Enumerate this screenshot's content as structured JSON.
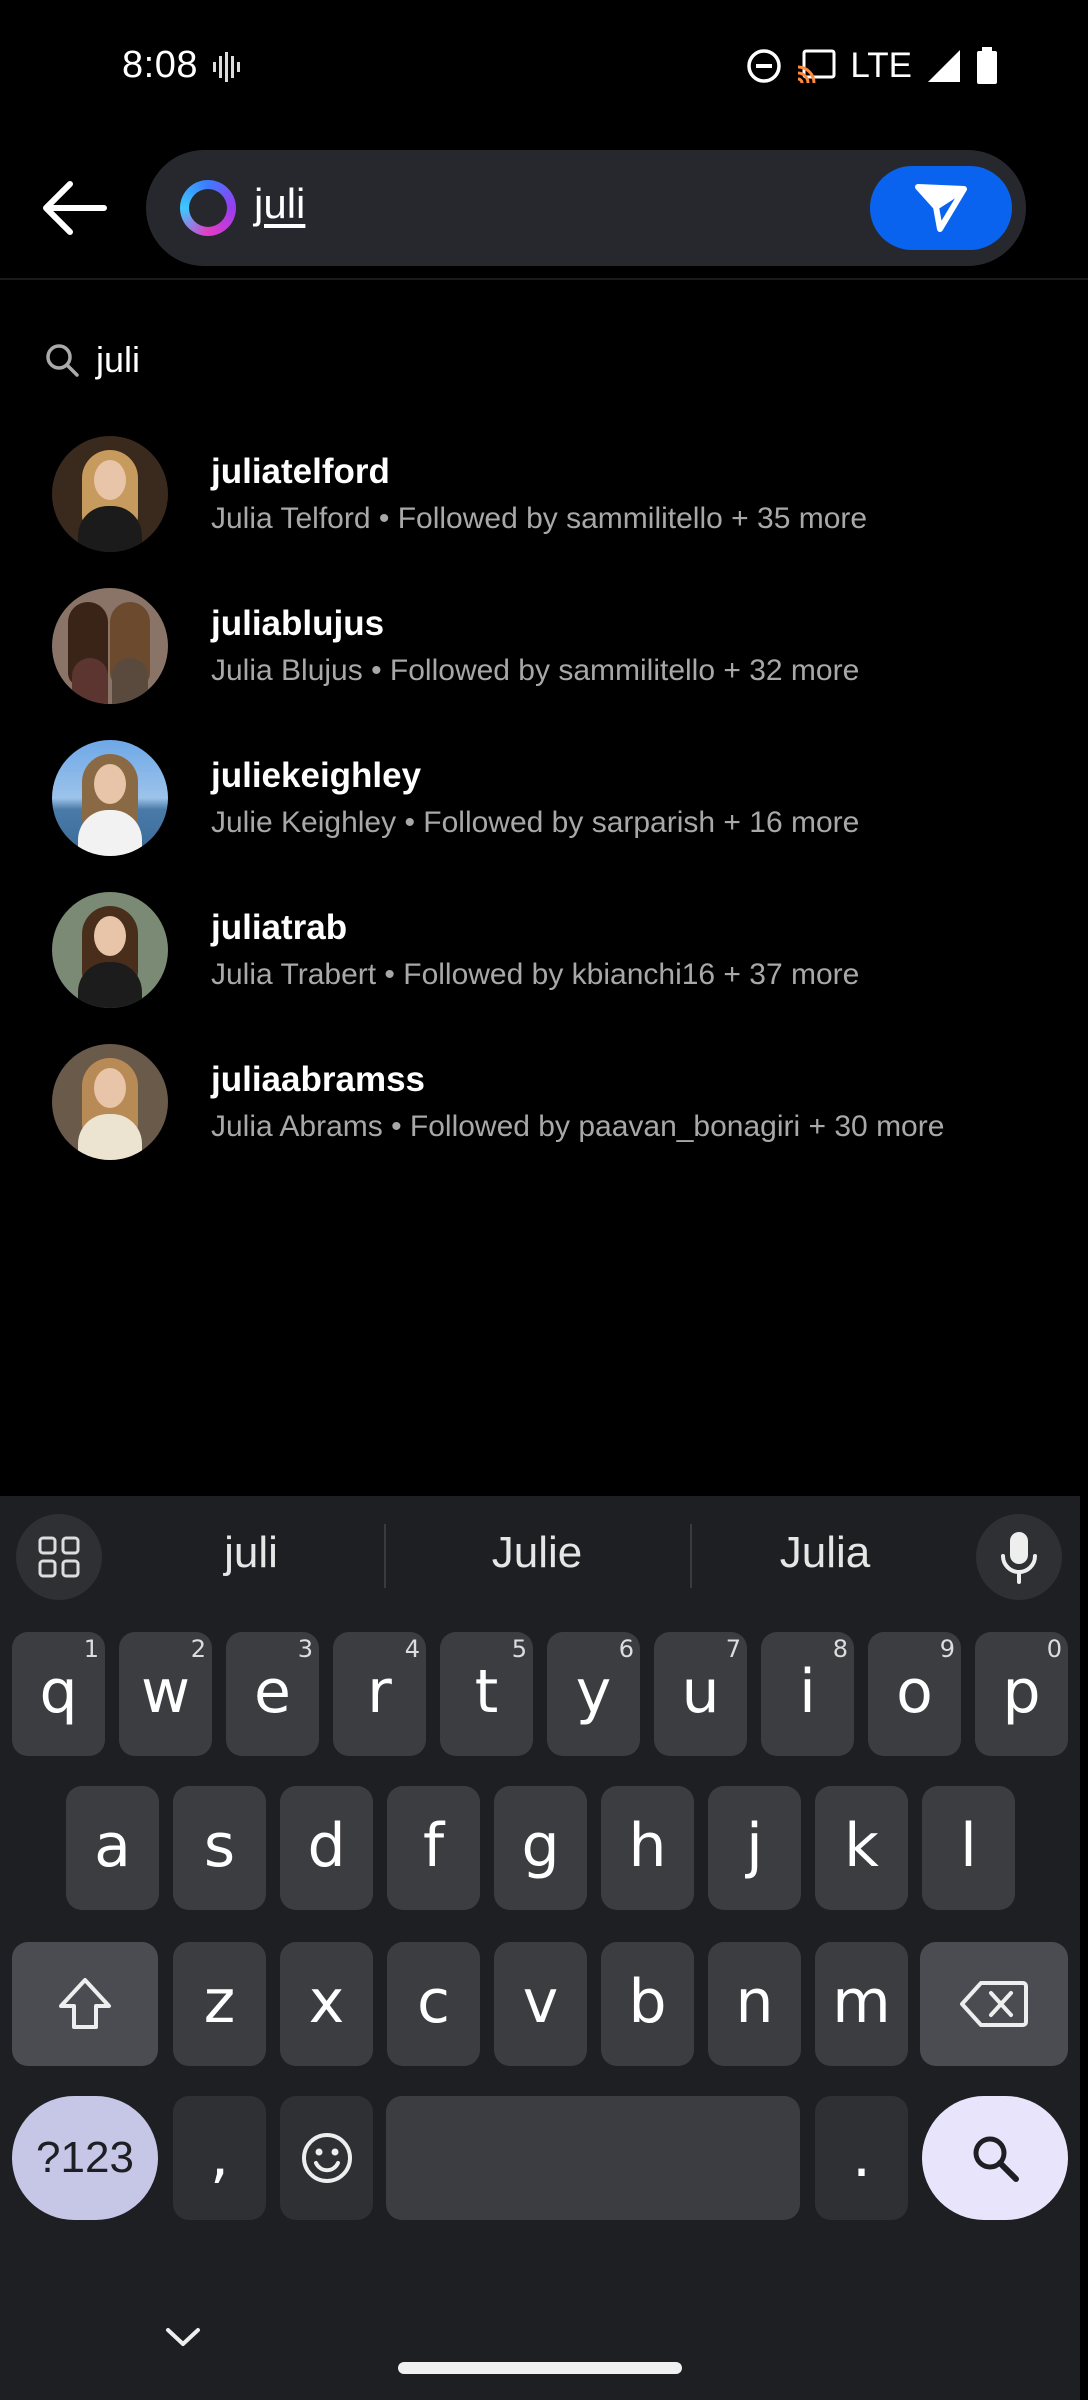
{
  "status_bar": {
    "time": "8:08",
    "network": "LTE"
  },
  "search": {
    "query": "juli",
    "suggestion": "juli"
  },
  "results": [
    {
      "username": "juliatelford",
      "subtitle": "Julia Telford • Followed by sammilitello + 35 more"
    },
    {
      "username": "juliablujus",
      "subtitle": "Julia Blujus • Followed by sammilitello + 32 more"
    },
    {
      "username": "juliekeighley",
      "subtitle": "Julie Keighley • Followed by sarparish + 16 more"
    },
    {
      "username": "juliatrab",
      "subtitle": "Julia Trabert • Followed by kbianchi16 + 37 more"
    },
    {
      "username": "juliaabramss",
      "subtitle": "Julia Abrams • Followed by paavan_bonagiri + 30 more"
    }
  ],
  "keyboard": {
    "suggestions": [
      "juli",
      "Julie",
      "Julia"
    ],
    "row1": [
      "q",
      "w",
      "e",
      "r",
      "t",
      "y",
      "u",
      "i",
      "o",
      "p"
    ],
    "row1_hints": [
      "1",
      "2",
      "3",
      "4",
      "5",
      "6",
      "7",
      "8",
      "9",
      "0"
    ],
    "row2": [
      "a",
      "s",
      "d",
      "f",
      "g",
      "h",
      "j",
      "k",
      "l"
    ],
    "row3": [
      "z",
      "x",
      "c",
      "v",
      "b",
      "n",
      "m"
    ],
    "symbols_label": "?123",
    "comma": ",",
    "period": "."
  }
}
